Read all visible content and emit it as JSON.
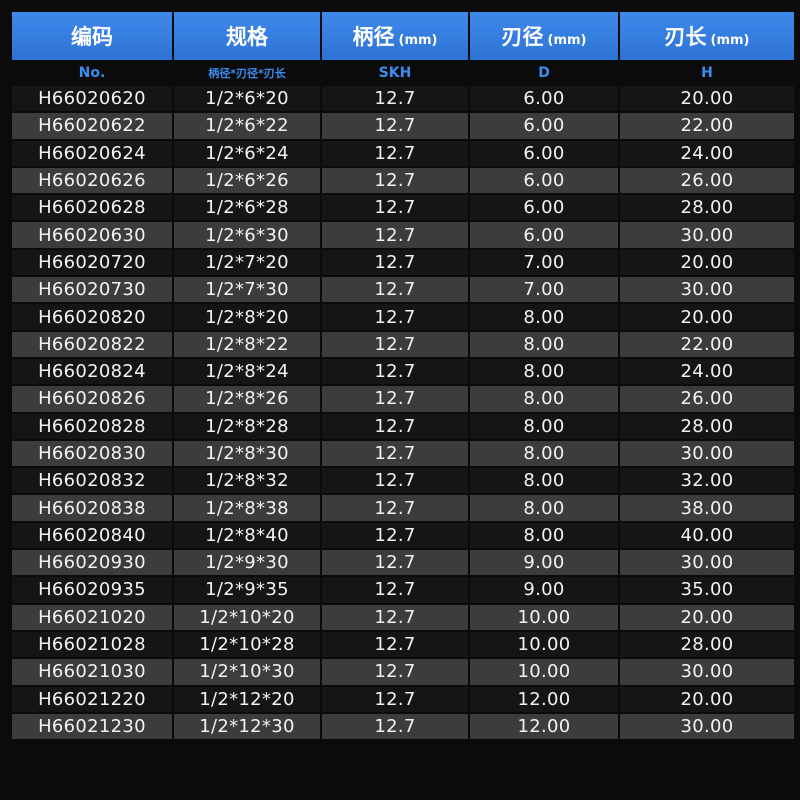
{
  "header": {
    "columns": [
      {
        "label": "编码",
        "unit": ""
      },
      {
        "label": "规格",
        "unit": ""
      },
      {
        "label": "柄径",
        "unit": "(mm)"
      },
      {
        "label": "刃径",
        "unit": "(mm)"
      },
      {
        "label": "刃长",
        "unit": "(mm)"
      }
    ],
    "subheaders": [
      "No.",
      "柄径*刃径*刃长",
      "SKH",
      "D",
      "H"
    ]
  },
  "colors": {
    "header_bg": "#2d73d6",
    "subheader_text": "#3b8ef0",
    "row_dark": "#151515",
    "row_light": "#3c3c3c"
  },
  "rows": [
    [
      "H66020620",
      "1/2*6*20",
      "12.7",
      "6.00",
      "20.00"
    ],
    [
      "H66020622",
      "1/2*6*22",
      "12.7",
      "6.00",
      "22.00"
    ],
    [
      "H66020624",
      "1/2*6*24",
      "12.7",
      "6.00",
      "24.00"
    ],
    [
      "H66020626",
      "1/2*6*26",
      "12.7",
      "6.00",
      "26.00"
    ],
    [
      "H66020628",
      "1/2*6*28",
      "12.7",
      "6.00",
      "28.00"
    ],
    [
      "H66020630",
      "1/2*6*30",
      "12.7",
      "6.00",
      "30.00"
    ],
    [
      "H66020720",
      "1/2*7*20",
      "12.7",
      "7.00",
      "20.00"
    ],
    [
      "H66020730",
      "1/2*7*30",
      "12.7",
      "7.00",
      "30.00"
    ],
    [
      "H66020820",
      "1/2*8*20",
      "12.7",
      "8.00",
      "20.00"
    ],
    [
      "H66020822",
      "1/2*8*22",
      "12.7",
      "8.00",
      "22.00"
    ],
    [
      "H66020824",
      "1/2*8*24",
      "12.7",
      "8.00",
      "24.00"
    ],
    [
      "H66020826",
      "1/2*8*26",
      "12.7",
      "8.00",
      "26.00"
    ],
    [
      "H66020828",
      "1/2*8*28",
      "12.7",
      "8.00",
      "28.00"
    ],
    [
      "H66020830",
      "1/2*8*30",
      "12.7",
      "8.00",
      "30.00"
    ],
    [
      "H66020832",
      "1/2*8*32",
      "12.7",
      "8.00",
      "32.00"
    ],
    [
      "H66020838",
      "1/2*8*38",
      "12.7",
      "8.00",
      "38.00"
    ],
    [
      "H66020840",
      "1/2*8*40",
      "12.7",
      "8.00",
      "40.00"
    ],
    [
      "H66020930",
      "1/2*9*30",
      "12.7",
      "9.00",
      "30.00"
    ],
    [
      "H66020935",
      "1/2*9*35",
      "12.7",
      "9.00",
      "35.00"
    ],
    [
      "H66021020",
      "1/2*10*20",
      "12.7",
      "10.00",
      "20.00"
    ],
    [
      "H66021028",
      "1/2*10*28",
      "12.7",
      "10.00",
      "28.00"
    ],
    [
      "H66021030",
      "1/2*10*30",
      "12.7",
      "10.00",
      "30.00"
    ],
    [
      "H66021220",
      "1/2*12*20",
      "12.7",
      "12.00",
      "20.00"
    ],
    [
      "H66021230",
      "1/2*12*30",
      "12.7",
      "12.00",
      "30.00"
    ]
  ]
}
